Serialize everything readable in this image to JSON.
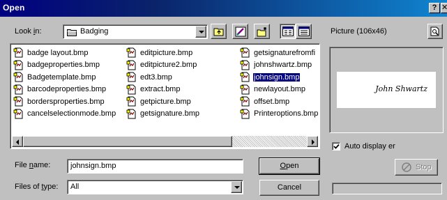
{
  "window": {
    "title": "Open",
    "help_button": "?",
    "close_button": "✕"
  },
  "lookin": {
    "label_prefix": "Look ",
    "label_hotkey": "i",
    "label_suffix": "n:",
    "value": "Badging"
  },
  "toolbar": {
    "up_folder": "up-folder-icon",
    "desktop": "desktop-icon",
    "new_folder": "new-folder-icon",
    "list_view": "list-view-icon",
    "details_view": "details-view-icon"
  },
  "files": {
    "columns": [
      [
        "badge layout.bmp",
        "badgeproperties.bmp",
        "Badgetemplate.bmp",
        "barcodeproperties.bmp",
        "bordersproperties.bmp",
        "cancelselectionmode.bmp"
      ],
      [
        "editpicture.bmp",
        "editpicture2.bmp",
        "edt3.bmp",
        "extract.bmp",
        "getpicture.bmp",
        "getsignature.bmp"
      ],
      [
        "getsignaturefromfi",
        "johnshwartz.bmp",
        "johnsign.bmp",
        "newlayout.bmp",
        "offset.bmp",
        "Printeroptions.bmp"
      ]
    ],
    "selected": "johnsign.bmp"
  },
  "filename": {
    "label_prefix": "File ",
    "label_hotkey": "n",
    "label_suffix": "ame:",
    "value": "johnsign.bmp"
  },
  "filetype": {
    "label_prefix": "Files of ",
    "label_hotkey": "t",
    "label_suffix": "ype:",
    "value": "All"
  },
  "buttons": {
    "open_hotkey": "O",
    "open_rest": "pen",
    "cancel": "Cancel"
  },
  "preview": {
    "label": "Picture (106x46)",
    "signature_text": "John Shwartz",
    "auto_display_label": "Auto display er",
    "auto_display_checked": true,
    "stop_label": "Stop"
  },
  "colors": {
    "title_bar": "#000080",
    "selection": "#000080",
    "face": "#c0c0c0"
  }
}
